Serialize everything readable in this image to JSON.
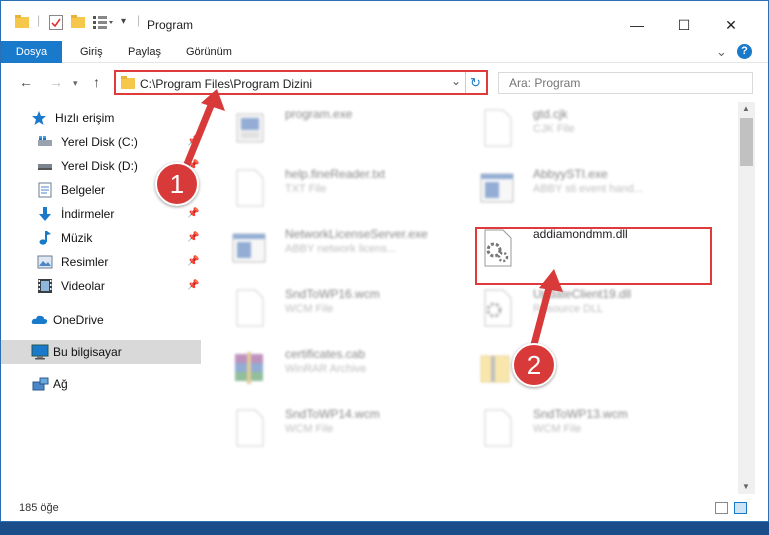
{
  "window": {
    "title": "Program",
    "controls": {
      "minimize": "—",
      "maximize": "☐",
      "close": "✕"
    }
  },
  "ribbon": {
    "tabs": [
      {
        "label": "Dosya"
      },
      {
        "label": "Giriş"
      },
      {
        "label": "Paylaş"
      },
      {
        "label": "Görünüm"
      }
    ],
    "help": "?",
    "collapse": "⌄"
  },
  "navigation": {
    "address": "C:\\Program Files\\Program Dizini",
    "search_placeholder": "Ara: Program"
  },
  "sidebar": {
    "items": [
      {
        "label": "Hızlı erişim",
        "icon": "star-icon"
      },
      {
        "label": "Yerel Disk (C:)",
        "icon": "drive-icon"
      },
      {
        "label": "Yerel Disk (D:)",
        "icon": "drive-icon"
      },
      {
        "label": "Belgeler",
        "icon": "documents-icon"
      },
      {
        "label": "İndirmeler",
        "icon": "download-icon"
      },
      {
        "label": "Müzik",
        "icon": "music-icon"
      },
      {
        "label": "Resimler",
        "icon": "pictures-icon"
      },
      {
        "label": "Videolar",
        "icon": "video-icon"
      },
      {
        "label": "OneDrive",
        "icon": "cloud-icon"
      },
      {
        "label": "Bu bilgisayar",
        "icon": "computer-icon",
        "selected": true
      },
      {
        "label": "Ağ",
        "icon": "network-icon"
      }
    ]
  },
  "files": [
    {
      "name": "program.exe",
      "type": "",
      "icon": "exe-icon"
    },
    {
      "name": "gtd.cjk",
      "type": "CJK File",
      "icon": "blank-file-icon"
    },
    {
      "name": "help.fineReader.txt",
      "type": "TXT File",
      "icon": "text-file-icon"
    },
    {
      "name": "AbbyySTI.exe",
      "type": "ABBY sti event hand...",
      "icon": "exe-window-icon"
    },
    {
      "name": "NetworkLicenseServer.exe",
      "type": "ABBY network licens...",
      "icon": "exe-window-icon"
    },
    {
      "name": "addiamondmm.dll",
      "type": "",
      "icon": "dll-gear-icon"
    },
    {
      "name": "SndToWP16.wcm",
      "type": "WCM File",
      "icon": "blank-file-icon"
    },
    {
      "name": "UpdateClient19.dll",
      "type": "Resource DLL",
      "icon": "dll-gear-icon"
    },
    {
      "name": "certificates.cab",
      "type": "WinRAR Archive",
      "icon": "winrar-icon"
    },
    {
      "name": "",
      "type": "",
      "icon": "zip-folder-icon"
    },
    {
      "name": "SndToWP14.wcm",
      "type": "WCM File",
      "icon": "blank-file-icon"
    },
    {
      "name": "SndToWP13.wcm",
      "type": "WCM File",
      "icon": "blank-file-icon"
    }
  ],
  "status": {
    "count": "185 öğe"
  },
  "annotations": {
    "marker1": "1",
    "marker2": "2"
  },
  "colors": {
    "accent": "#1979ca",
    "annotation": "#d83a3a"
  }
}
